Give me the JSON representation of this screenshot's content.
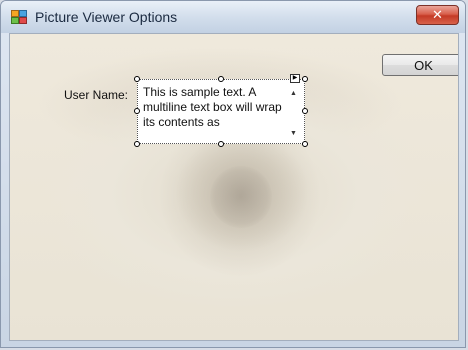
{
  "window": {
    "title": "Picture Viewer Options",
    "close_glyph": "✕",
    "icon": "form-icon"
  },
  "form": {
    "ok_label": "OK",
    "user_name_label": "User Name:",
    "textbox_text": "This is sample text. A multiline text box will wrap its contents as",
    "scroll_up_glyph": "▲",
    "scroll_down_glyph": "▼",
    "smart_tag_glyph": "▶"
  },
  "colors": {
    "close_button": "#c43a26",
    "titlebar": "#d3deec"
  }
}
